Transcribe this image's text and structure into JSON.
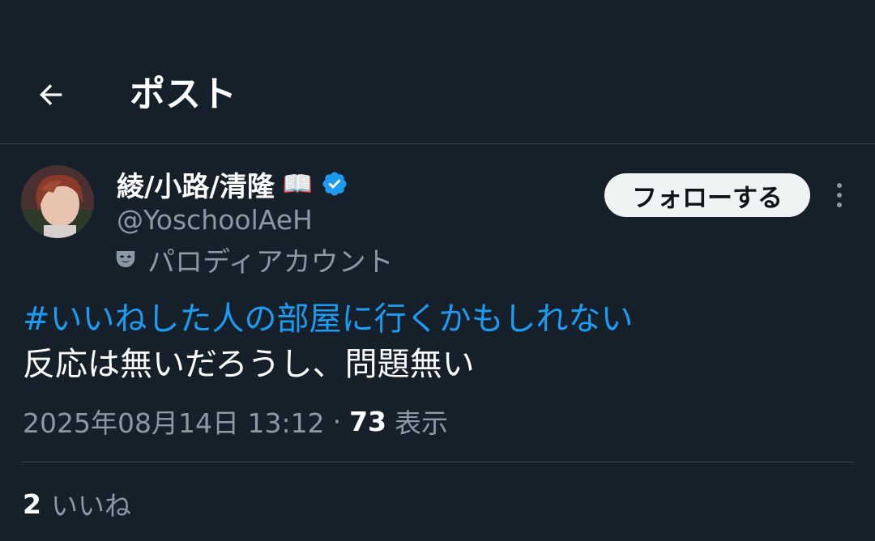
{
  "header": {
    "title": "ポスト",
    "back_icon": "arrow-left-icon"
  },
  "author": {
    "display_name": "綾/小路/清隆",
    "name_emoji": "📖",
    "verified_color": "#1d9bf0",
    "username": "@YoschoolAeH",
    "label": "パロディアカウント",
    "label_icon": "theater-mask-icon"
  },
  "follow_button": {
    "label": "フォローする"
  },
  "more_icon": "more-vertical-icon",
  "tweet": {
    "hashtag": "#いいねした人の部屋に行くかもしれない",
    "body": "反応は無いだろうし、問題無い"
  },
  "meta": {
    "datetime": "2025年08月14日 13:12",
    "separator": "·",
    "views_count": "73",
    "views_label": "表示"
  },
  "stats": {
    "likes_count": "2",
    "likes_label": "いいね"
  },
  "colors": {
    "background": "#15202b",
    "accent": "#1d9bf0",
    "secondary_text": "#8b98a5",
    "divider": "#38444d"
  }
}
